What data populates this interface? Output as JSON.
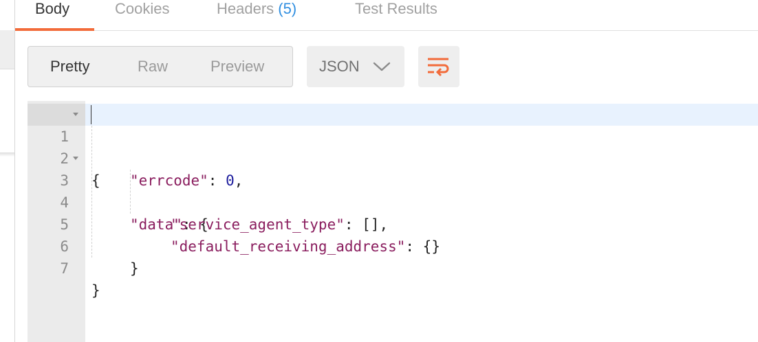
{
  "tabs": [
    {
      "label": "Body",
      "active": true
    },
    {
      "label": "Cookies",
      "active": false
    },
    {
      "label": "Headers",
      "count": "(5)",
      "active": false
    },
    {
      "label": "Test Results",
      "active": false
    }
  ],
  "toolbar": {
    "view_modes": [
      {
        "label": "Pretty",
        "active": true
      },
      {
        "label": "Raw",
        "active": false
      },
      {
        "label": "Preview",
        "active": false
      }
    ],
    "format": {
      "selected": "JSON",
      "icon": "chevron-down-icon"
    },
    "wrap_icon": "wrap-lines-icon"
  },
  "colors": {
    "accent": "#f26b3a",
    "count": "#2f8ee0",
    "json_key": "#8a1d5e",
    "json_number": "#1b1b9c",
    "active_line": "#e8f2fe"
  },
  "editor": {
    "lines": [
      {
        "num": "1",
        "fold": true
      },
      {
        "num": "2",
        "fold": false,
        "key": "\"errcode\"",
        "sep": ": ",
        "value": "0",
        "trail": ","
      },
      {
        "num": "3",
        "fold": true,
        "key": "\"data\"",
        "sep": ": ",
        "trail": "{"
      },
      {
        "num": "4",
        "fold": false,
        "key": "\"service_agent_type\"",
        "sep": ": ",
        "trail": "[],"
      },
      {
        "num": "5",
        "fold": false,
        "key": "\"default_receiving_address\"",
        "sep": ": ",
        "trail": "{}"
      },
      {
        "num": "6",
        "fold": false,
        "trail": "}"
      },
      {
        "num": "7",
        "fold": false,
        "trail": "}"
      }
    ],
    "line1_text": "{"
  }
}
